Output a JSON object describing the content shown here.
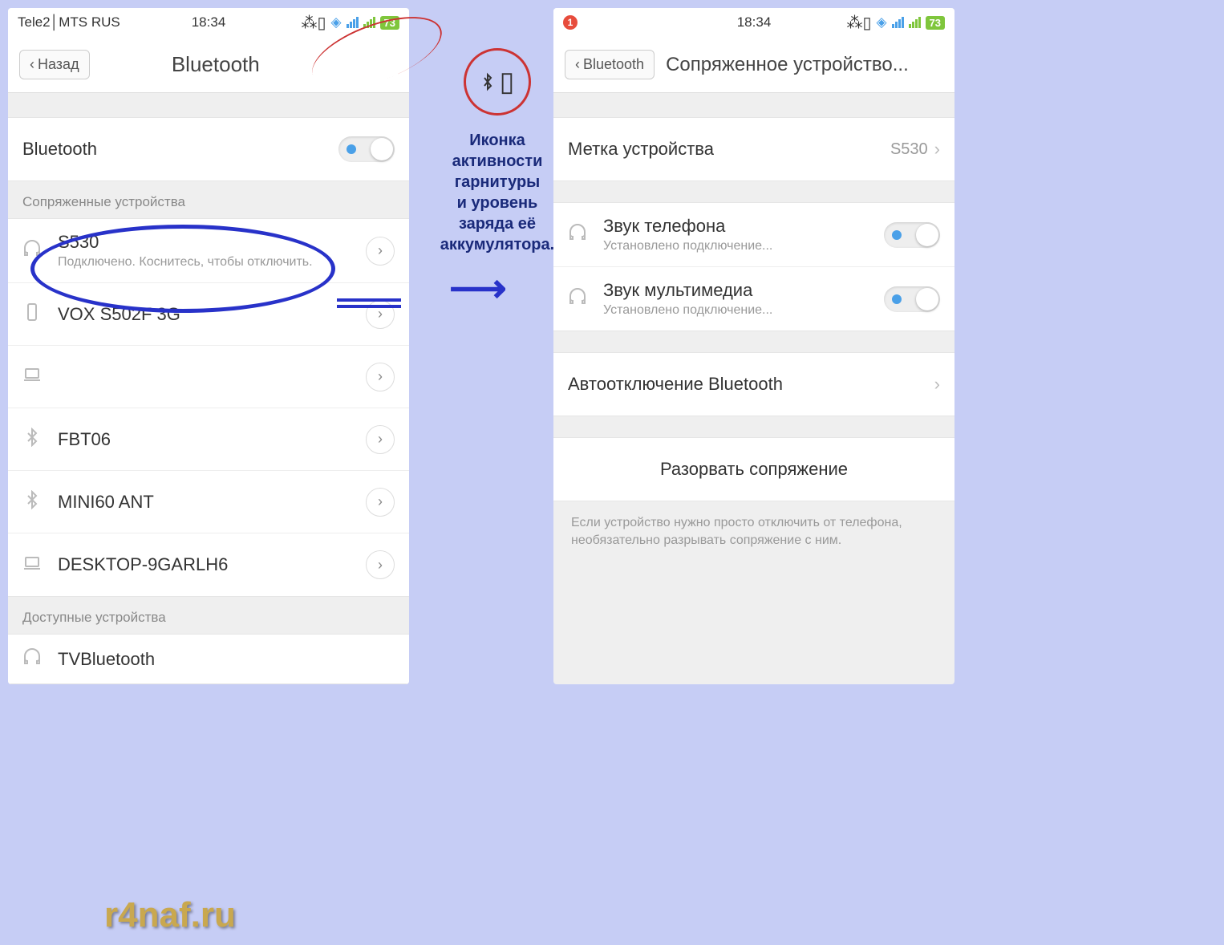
{
  "left": {
    "status": {
      "carrier": "Tele2│MTS RUS",
      "time": "18:34",
      "battery": "73"
    },
    "header": {
      "back": "Назад",
      "title": "Bluetooth"
    },
    "toggle_row": "Bluetooth",
    "section1": "Сопряженные устройства",
    "devices": [
      {
        "name": "S530",
        "sub": "Подключено. Коснитесь, чтобы отключить.",
        "icon": "headphones"
      },
      {
        "name": "VOX S502F 3G",
        "icon": "phone"
      },
      {
        "name": "",
        "icon": "laptop"
      },
      {
        "name": "FBT06",
        "icon": "bt"
      },
      {
        "name": "MINI60 ANT",
        "icon": "bt"
      },
      {
        "name": "DESKTOP-9GARLH6",
        "icon": "laptop"
      }
    ],
    "section2": "Доступные устройства",
    "avail": [
      {
        "name": "TVBluetooth",
        "icon": "headphones"
      }
    ]
  },
  "right": {
    "status": {
      "notif": "1",
      "time": "18:34",
      "battery": "73"
    },
    "header": {
      "back": "Bluetooth",
      "title": "Сопряженное устройство..."
    },
    "label_row": {
      "label": "Метка устройства",
      "value": "S530"
    },
    "profiles": [
      {
        "name": "Звук телефона",
        "sub": "Установлено подключение..."
      },
      {
        "name": "Звук мультимедиа",
        "sub": "Установлено подключение..."
      }
    ],
    "auto": "Автоотключение Bluetooth",
    "unpair": "Разорвать сопряжение",
    "hint": "Если устройство нужно просто отключить от телефона, необязательно разрывать сопряжение с ним."
  },
  "annotation": "Иконка\nактивности\nгарнитуры\nи уровень\nзаряда её\nаккумулятора.",
  "watermark": "r4naf.ru"
}
